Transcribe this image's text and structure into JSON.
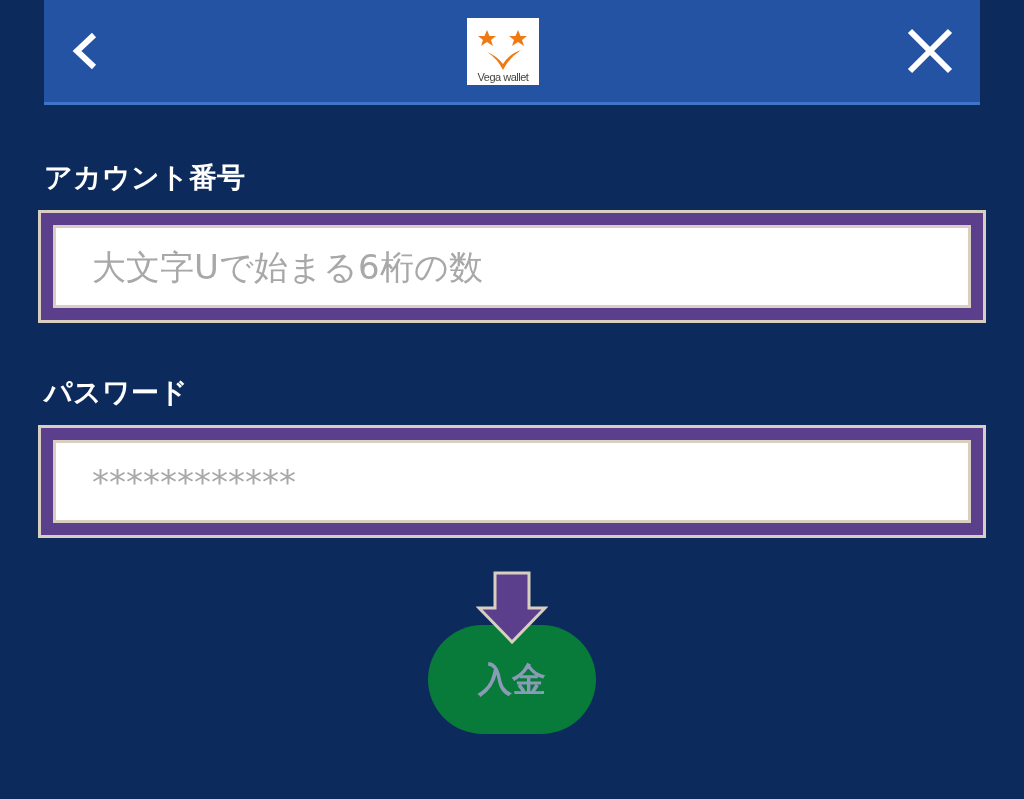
{
  "header": {
    "logo_text": "Vega wallet"
  },
  "fields": [
    {
      "label": "アカウント番号",
      "placeholder": "大文字Uで始まる6桁の数"
    },
    {
      "label": "パスワード",
      "placeholder": "************"
    }
  ],
  "submit_button": {
    "label": "入金"
  }
}
